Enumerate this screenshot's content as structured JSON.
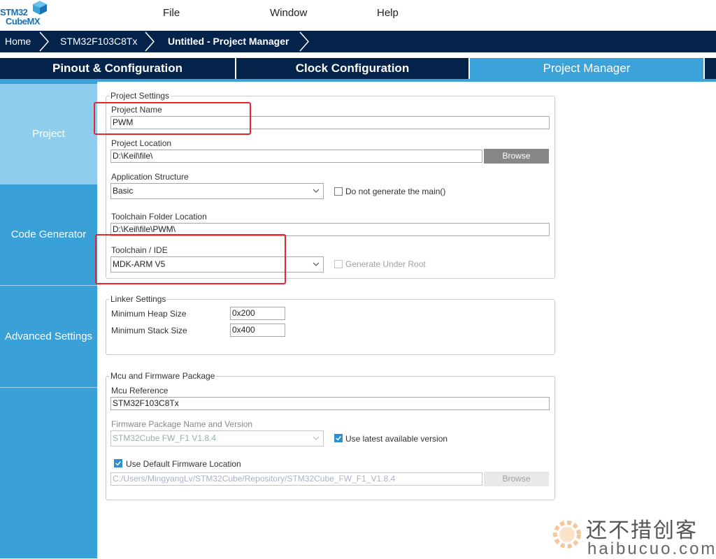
{
  "app": {
    "logo_line1": "STM32",
    "logo_line2": "CubeMX"
  },
  "menu": {
    "file": "File",
    "window": "Window",
    "help": "Help"
  },
  "breadcrumb": {
    "home": "Home",
    "device": "STM32F103C8Tx",
    "current": "Untitled - Project Manager"
  },
  "tabs": [
    {
      "label": "Pinout & Configuration"
    },
    {
      "label": "Clock Configuration"
    },
    {
      "label": "Project Manager"
    }
  ],
  "sidebar": {
    "items": [
      {
        "label": "Project"
      },
      {
        "label": "Code Generator"
      },
      {
        "label": "Advanced Settings"
      }
    ]
  },
  "project_settings": {
    "title": "Project Settings",
    "project_name_label": "Project Name",
    "project_name": "PWM",
    "project_location_label": "Project Location",
    "project_location": "D:\\Keil\\file\\",
    "browse_label": "Browse",
    "app_structure_label": "Application Structure",
    "app_structure": "Basic",
    "no_main_label": "Do not generate the main()",
    "toolchain_folder_label": "Toolchain Folder Location",
    "toolchain_folder": "D:\\Keil\\file\\PWM\\",
    "toolchain_label": "Toolchain / IDE",
    "toolchain": "MDK-ARM V5",
    "gen_under_root_label": "Generate Under Root"
  },
  "linker_settings": {
    "title": "Linker Settings",
    "heap_label": "Minimum Heap Size",
    "heap": "0x200",
    "stack_label": "Minimum Stack Size",
    "stack": "0x400"
  },
  "mcu_firmware": {
    "title": "Mcu and Firmware Package",
    "mcu_ref_label": "Mcu Reference",
    "mcu_ref": "STM32F103C8Tx",
    "fw_label": "Firmware Package Name and Version",
    "fw": "STM32Cube FW_F1 V1.8.4",
    "use_latest_label": "Use latest available version",
    "use_default_label": "Use Default Firmware Location",
    "fw_location": "C:/Users/MingyangLv/STM32Cube/Repository/STM32Cube_FW_F1_V1.8.4",
    "browse_label": "Browse"
  },
  "watermark": {
    "line1": "还不措创客",
    "line2": "haibucuo.com"
  },
  "colors": {
    "navy": "#03234b",
    "accent": "#3ba3da",
    "sidebar_active": "#8fcdee",
    "highlight": "#e8262a"
  }
}
